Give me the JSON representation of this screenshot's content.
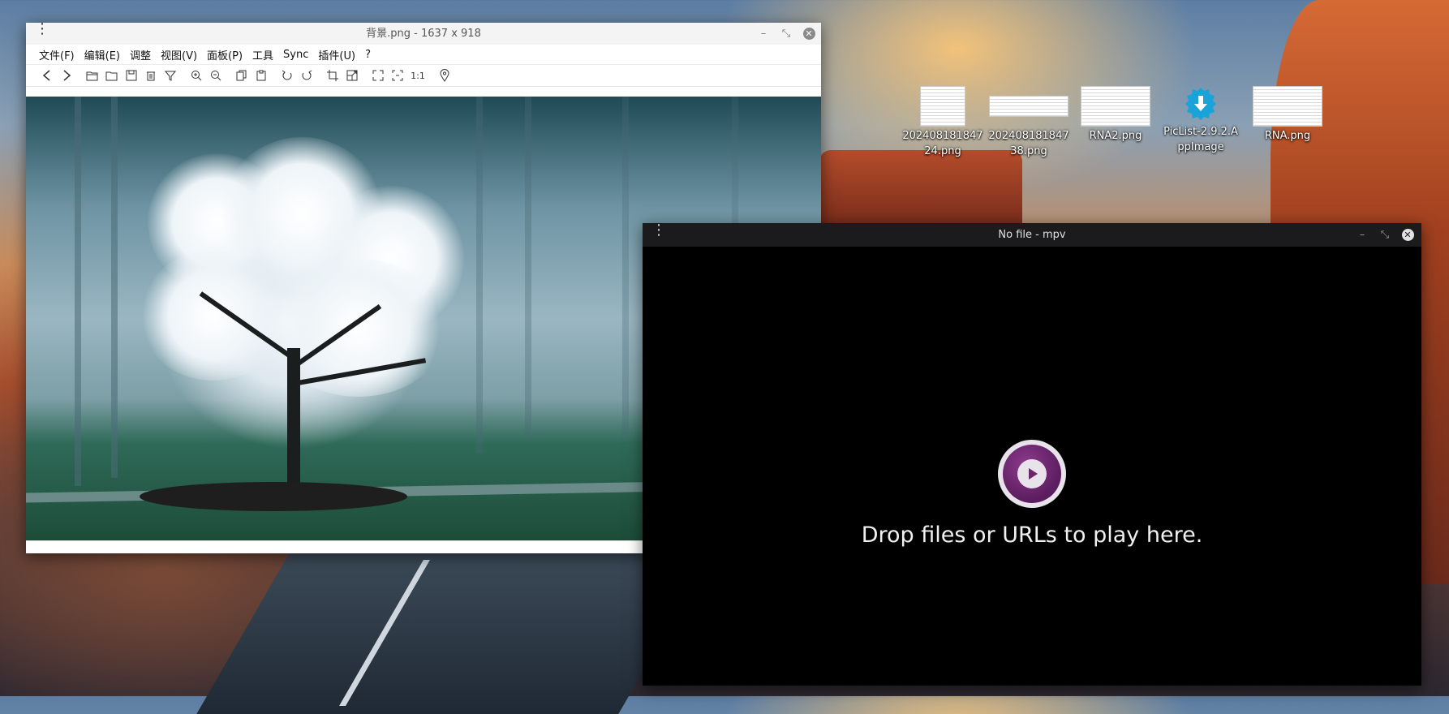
{
  "desktop": {
    "icons": [
      {
        "label": "20240818184724.png",
        "kind": "doc"
      },
      {
        "label": "20240818184738.png",
        "kind": "wide"
      },
      {
        "label": "RNA2.png",
        "kind": "sheet"
      },
      {
        "label": "PicList-2.9.2.AppImage",
        "kind": "app"
      },
      {
        "label": "RNA.png",
        "kind": "sheet"
      }
    ]
  },
  "image_viewer": {
    "title": "背景.png - 1637 x 918",
    "menu": [
      "文件(F)",
      "编辑(E)",
      "调整",
      "视图(V)",
      "面板(P)",
      "工具",
      "Sync",
      "插件(U)",
      "?"
    ],
    "toolbar_icons": [
      "back-icon",
      "forward-icon",
      "open-folder-icon",
      "folder-icon",
      "save-icon",
      "delete-icon",
      "filter-icon",
      "zoom-in-icon",
      "zoom-out-icon",
      "copy-icon",
      "paste-icon",
      "rotate-left-icon",
      "rotate-right-icon",
      "crop-icon",
      "resize-icon",
      "fullscreen-icon",
      "fit-icon",
      "actual-size-icon",
      "location-pin-icon"
    ],
    "actual_size_label": "1:1"
  },
  "mpv": {
    "title": "No file - mpv",
    "hint": "Drop files or URLs to play here."
  }
}
